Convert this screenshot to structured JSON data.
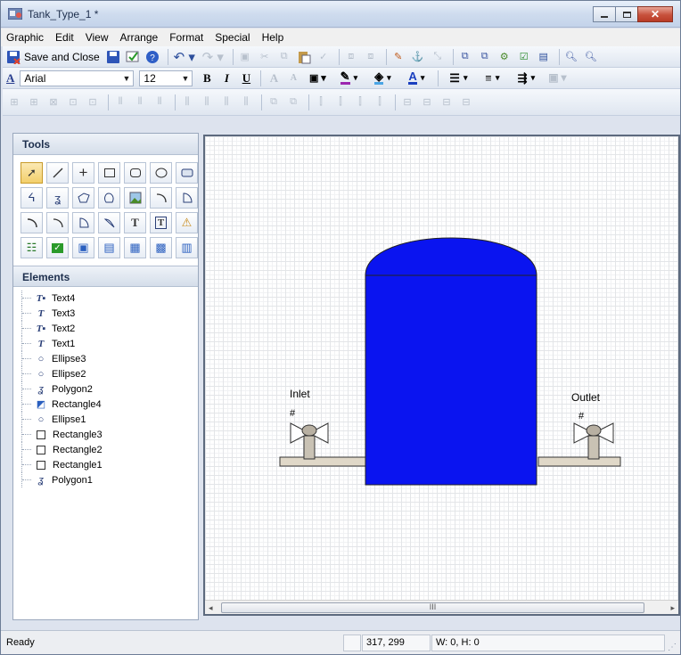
{
  "window": {
    "title": "Tank_Type_1 *"
  },
  "menu": [
    "Graphic",
    "Edit",
    "View",
    "Arrange",
    "Format",
    "Special",
    "Help"
  ],
  "toolbar": {
    "save_close_label": "Save and Close"
  },
  "format": {
    "font_family": "Arial",
    "font_size": "12",
    "bold": "B",
    "italic": "I",
    "underline": "U"
  },
  "tools": {
    "title": "Tools"
  },
  "elements": {
    "title": "Elements",
    "items": [
      {
        "label": "Text4",
        "icon": "text-image-icon"
      },
      {
        "label": "Text3",
        "icon": "text-icon"
      },
      {
        "label": "Text2",
        "icon": "text-image-icon"
      },
      {
        "label": "Text1",
        "icon": "text-icon"
      },
      {
        "label": "Ellipse3",
        "icon": "ellipse-icon"
      },
      {
        "label": "Ellipse2",
        "icon": "ellipse-icon"
      },
      {
        "label": "Polygon2",
        "icon": "polygon-icon"
      },
      {
        "label": "Rectangle4",
        "icon": "rectangle-fill-icon"
      },
      {
        "label": "Ellipse1",
        "icon": "ellipse-icon"
      },
      {
        "label": "Rectangle3",
        "icon": "rectangle-icon"
      },
      {
        "label": "Rectangle2",
        "icon": "rectangle-icon"
      },
      {
        "label": "Rectangle1",
        "icon": "rectangle-icon"
      },
      {
        "label": "Polygon1",
        "icon": "polygon-icon"
      }
    ]
  },
  "canvas": {
    "inlet_label": "Inlet",
    "outlet_label": "Outlet",
    "inlet_value": "#",
    "outlet_value": "#",
    "tank_color": "#0a14f0"
  },
  "scrollbar": {
    "thumb_grip": "III"
  },
  "status": {
    "text": "Ready",
    "position": "317, 299",
    "size": "W: 0, H: 0"
  }
}
